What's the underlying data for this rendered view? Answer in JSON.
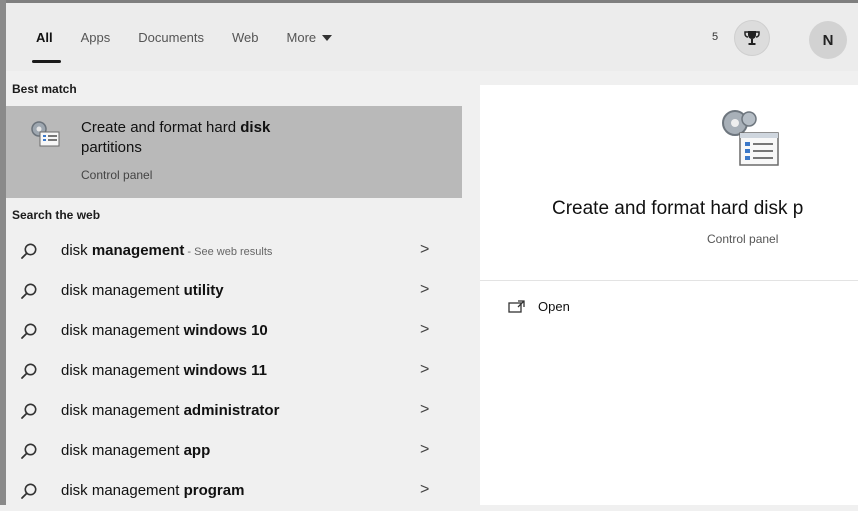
{
  "tabs": {
    "all": "All",
    "apps": "Apps",
    "documents": "Documents",
    "web": "Web",
    "more": "More"
  },
  "header": {
    "points": "5",
    "avatar_initial": "N"
  },
  "left": {
    "best_match_heading": "Best match",
    "best_match": {
      "title_plain": "Create and format hard ",
      "title_bold": "disk",
      "title_line2": "partitions",
      "subtitle": "Control panel"
    },
    "search_web_heading": "Search the web",
    "results": [
      {
        "plain": "disk ",
        "bold": "management",
        "hint": " - See web results"
      },
      {
        "plain": "disk management ",
        "bold": "utility",
        "hint": ""
      },
      {
        "plain": "disk management ",
        "bold": "windows 10",
        "hint": ""
      },
      {
        "plain": "disk management ",
        "bold": "windows 11",
        "hint": ""
      },
      {
        "plain": "disk management ",
        "bold": "administrator",
        "hint": ""
      },
      {
        "plain": "disk management ",
        "bold": "app",
        "hint": ""
      },
      {
        "plain": "disk management ",
        "bold": "program",
        "hint": ""
      }
    ],
    "chevron": ">"
  },
  "right": {
    "title": "Create and format hard disk p",
    "subtitle": "Control panel",
    "open_label": "Open"
  }
}
